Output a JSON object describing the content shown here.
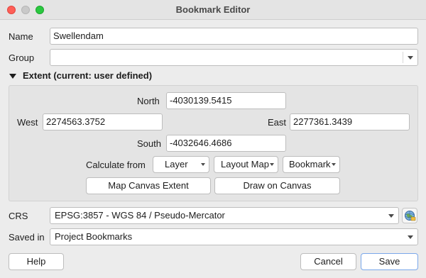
{
  "window": {
    "title": "Bookmark Editor"
  },
  "name": {
    "label": "Name",
    "value": "Swellendam"
  },
  "group": {
    "label": "Group",
    "value": ""
  },
  "extent": {
    "header": "Extent (current: user defined)",
    "north_label": "North",
    "north_value": "-4030139.5415",
    "west_label": "West",
    "west_value": "2274563.3752",
    "east_label": "East",
    "east_value": "2277361.3439",
    "south_label": "South",
    "south_value": "-4032646.4686",
    "calc_label": "Calculate from",
    "layer_btn": "Layer",
    "layout_map_btn": "Layout Map",
    "bookmark_btn": "Bookmark",
    "map_canvas_extent_btn": "Map Canvas Extent",
    "draw_on_canvas_btn": "Draw on Canvas"
  },
  "crs": {
    "label": "CRS",
    "value": "EPSG:3857 - WGS 84 / Pseudo-Mercator"
  },
  "saved_in": {
    "label": "Saved in",
    "value": "Project Bookmarks"
  },
  "buttons": {
    "help": "Help",
    "cancel": "Cancel",
    "save": "Save"
  },
  "colors": {
    "accent": "#7aa7ea",
    "close": "#fe5f57",
    "maximize": "#2ac840"
  }
}
